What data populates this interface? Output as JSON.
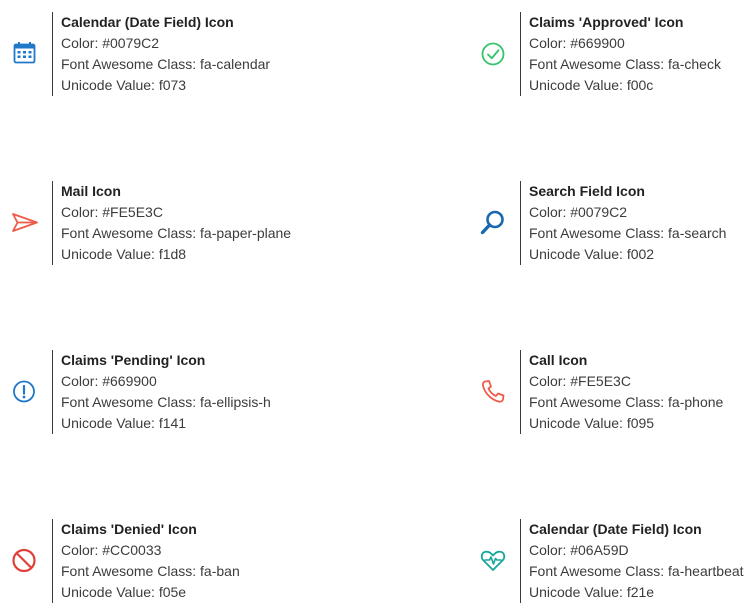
{
  "labels": {
    "color": "Color: ",
    "fa_class": "Font Awesome Class: ",
    "unicode": "Unicode Value: "
  },
  "icons": [
    {
      "title": "Calendar (Date Field) Icon",
      "color": "#0079C2",
      "fa_class": "fa-calendar",
      "unicode": "f073",
      "icon_name": "calendar-icon"
    },
    {
      "title": "Claims 'Approved' Icon",
      "color": "#669900",
      "fa_class": "fa-check",
      "unicode": "f00c",
      "icon_name": "check-circle-icon"
    },
    {
      "title": "Mail Icon",
      "color": "#FE5E3C",
      "fa_class": "fa-paper-plane",
      "unicode": "f1d8",
      "icon_name": "paper-plane-icon"
    },
    {
      "title": "Search Field Icon",
      "color": "#0079C2",
      "fa_class": "fa-search",
      "unicode": "f002",
      "icon_name": "search-icon"
    },
    {
      "title": "Claims 'Pending' Icon",
      "color": "#669900",
      "fa_class": "fa-ellipsis-h",
      "unicode": "f141",
      "icon_name": "exclamation-circle-icon"
    },
    {
      "title": "Call Icon",
      "color": "#FE5E3C",
      "fa_class": "fa-phone",
      "unicode": "f095",
      "icon_name": "phone-icon"
    },
    {
      "title": "Claims 'Denied' Icon",
      "color": "#CC0033",
      "fa_class": "fa-ban",
      "unicode": "f05e",
      "icon_name": "ban-icon"
    },
    {
      "title": "Calendar (Date Field) Icon",
      "color": "#06A59D",
      "fa_class": "fa-heartbeat",
      "unicode": "f21e",
      "icon_name": "heartbeat-icon"
    }
  ],
  "icon_render_colors": {
    "calendar": "#1f78c8",
    "check": "#36c36a",
    "plane": "#ef5a4a",
    "search": "#1768b0",
    "pending": "#1f78c8",
    "phone": "#ef5a4a",
    "ban": "#e0403a",
    "heartbeat": "#16a69a"
  }
}
